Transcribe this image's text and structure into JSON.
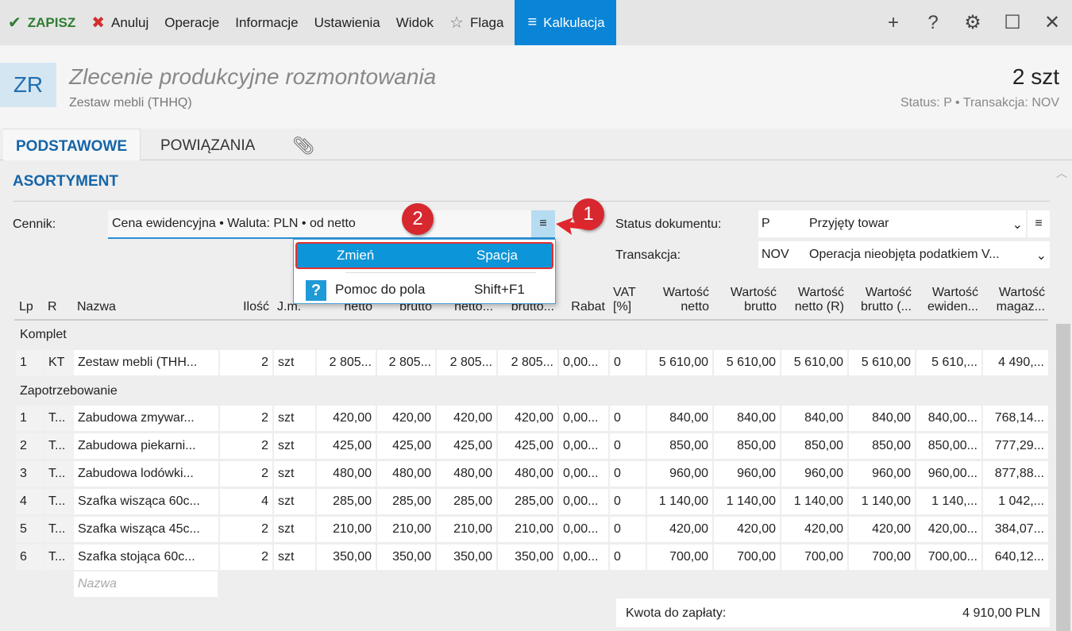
{
  "toolbar": {
    "save": "ZAPISZ",
    "cancel": "Anuluj",
    "operations": "Operacje",
    "info": "Informacje",
    "settings": "Ustawienia",
    "view": "Widok",
    "flag": "Flaga",
    "calc": "Kalkulacja"
  },
  "header": {
    "badge": "ZR",
    "title": "Zlecenie produkcyjne rozmontowania",
    "subtitle": "Zestaw mebli (THHQ)",
    "quantity": "2 szt",
    "status": "Status:  P  •  Transakcja:  NOV"
  },
  "tabs": [
    "PODSTAWOWE",
    "POWIĄZANIA"
  ],
  "section": "ASORTYMENT",
  "form": {
    "cennik_label": "Cennik:",
    "cennik_value": "Cena ewidencyjna • Waluta: PLN • od netto",
    "status_label": "Status dokumentu:",
    "status_code": "P",
    "status_value": "Przyjęty towar",
    "trans_label": "Transakcja:",
    "trans_code": "NOV",
    "trans_value": "Operacja nieobjęta podatkiem V..."
  },
  "menu": {
    "items": [
      {
        "label": "Zmień",
        "shortcut": "Spacja"
      },
      {
        "label": "Pomoc do pola",
        "shortcut": "Shift+F1"
      }
    ]
  },
  "callouts": [
    "1",
    "2"
  ],
  "table": {
    "headers": [
      [
        "",
        "Lp"
      ],
      [
        "",
        "R"
      ],
      [
        "",
        "Nazwa"
      ],
      [
        "",
        "Ilość"
      ],
      [
        "",
        "J.m."
      ],
      [
        "",
        "netto"
      ],
      [
        "",
        "brutto"
      ],
      [
        "",
        "netto..."
      ],
      [
        "",
        "brutto..."
      ],
      [
        "",
        "Rabat"
      ],
      [
        "VAT",
        "[%]"
      ],
      [
        "Wartość",
        "netto"
      ],
      [
        "Wartość",
        "brutto"
      ],
      [
        "Wartość",
        "netto (R)"
      ],
      [
        "Wartość",
        "brutto (..."
      ],
      [
        "Wartość",
        "ewiden..."
      ],
      [
        "Wartość",
        "magaz..."
      ]
    ],
    "groups": [
      "Komplet",
      "Zapotrzebowanie"
    ],
    "komplet": [
      [
        "1",
        "KT",
        "Zestaw mebli (THH...",
        "2",
        "szt",
        "2 805...",
        "2 805...",
        "2 805...",
        "2 805...",
        "0,00...",
        "0",
        "5 610,00",
        "5 610,00",
        "5 610,00",
        "5 610,00",
        "5 610,...",
        "4 490,..."
      ]
    ],
    "rows": [
      [
        "1",
        "T...",
        "Zabudowa zmywar...",
        "2",
        "szt",
        "420,00",
        "420,00",
        "420,00",
        "420,00",
        "0,00...",
        "0",
        "840,00",
        "840,00",
        "840,00",
        "840,00",
        "840,00...",
        "768,14..."
      ],
      [
        "2",
        "T...",
        "Zabudowa piekarni...",
        "2",
        "szt",
        "425,00",
        "425,00",
        "425,00",
        "425,00",
        "0,00...",
        "0",
        "850,00",
        "850,00",
        "850,00",
        "850,00",
        "850,00...",
        "777,29..."
      ],
      [
        "3",
        "T...",
        "Zabudowa lodówki...",
        "2",
        "szt",
        "480,00",
        "480,00",
        "480,00",
        "480,00",
        "0,00...",
        "0",
        "960,00",
        "960,00",
        "960,00",
        "960,00",
        "960,00...",
        "877,88..."
      ],
      [
        "4",
        "T...",
        "Szafka wisząca 60c...",
        "4",
        "szt",
        "285,00",
        "285,00",
        "285,00",
        "285,00",
        "0,00...",
        "0",
        "1 140,00",
        "1 140,00",
        "1 140,00",
        "1 140,00",
        "1 140,...",
        "1 042,..."
      ],
      [
        "5",
        "T...",
        "Szafka wisząca 45c...",
        "2",
        "szt",
        "210,00",
        "210,00",
        "210,00",
        "210,00",
        "0,00...",
        "0",
        "420,00",
        "420,00",
        "420,00",
        "420,00",
        "420,00...",
        "384,07..."
      ],
      [
        "6",
        "T...",
        "Szafka stojąca 60c...",
        "2",
        "szt",
        "350,00",
        "350,00",
        "350,00",
        "350,00",
        "0,00...",
        "0",
        "700,00",
        "700,00",
        "700,00",
        "700,00",
        "700,00...",
        "640,12..."
      ]
    ],
    "new_placeholder": "Nazwa"
  },
  "total": {
    "label": "Kwota do zapłaty:",
    "value": "4 910,00 PLN"
  }
}
